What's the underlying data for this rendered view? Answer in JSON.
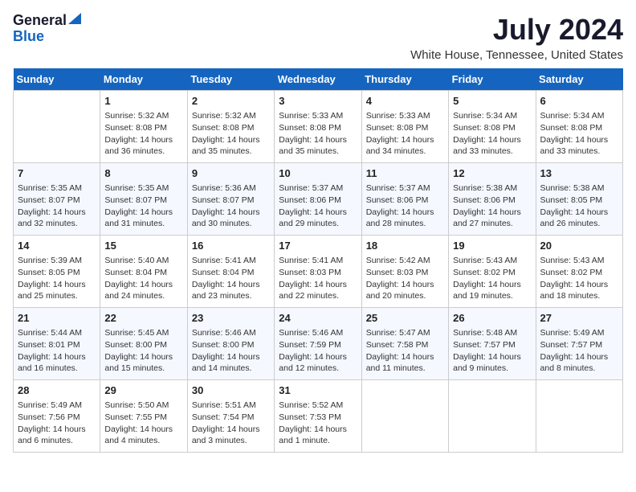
{
  "logo": {
    "general": "General",
    "blue": "Blue"
  },
  "title": "July 2024",
  "location": "White House, Tennessee, United States",
  "days_of_week": [
    "Sunday",
    "Monday",
    "Tuesday",
    "Wednesday",
    "Thursday",
    "Friday",
    "Saturday"
  ],
  "weeks": [
    [
      {
        "day": "",
        "content": ""
      },
      {
        "day": "1",
        "content": "Sunrise: 5:32 AM\nSunset: 8:08 PM\nDaylight: 14 hours\nand 36 minutes."
      },
      {
        "day": "2",
        "content": "Sunrise: 5:32 AM\nSunset: 8:08 PM\nDaylight: 14 hours\nand 35 minutes."
      },
      {
        "day": "3",
        "content": "Sunrise: 5:33 AM\nSunset: 8:08 PM\nDaylight: 14 hours\nand 35 minutes."
      },
      {
        "day": "4",
        "content": "Sunrise: 5:33 AM\nSunset: 8:08 PM\nDaylight: 14 hours\nand 34 minutes."
      },
      {
        "day": "5",
        "content": "Sunrise: 5:34 AM\nSunset: 8:08 PM\nDaylight: 14 hours\nand 33 minutes."
      },
      {
        "day": "6",
        "content": "Sunrise: 5:34 AM\nSunset: 8:08 PM\nDaylight: 14 hours\nand 33 minutes."
      }
    ],
    [
      {
        "day": "7",
        "content": "Sunrise: 5:35 AM\nSunset: 8:07 PM\nDaylight: 14 hours\nand 32 minutes."
      },
      {
        "day": "8",
        "content": "Sunrise: 5:35 AM\nSunset: 8:07 PM\nDaylight: 14 hours\nand 31 minutes."
      },
      {
        "day": "9",
        "content": "Sunrise: 5:36 AM\nSunset: 8:07 PM\nDaylight: 14 hours\nand 30 minutes."
      },
      {
        "day": "10",
        "content": "Sunrise: 5:37 AM\nSunset: 8:06 PM\nDaylight: 14 hours\nand 29 minutes."
      },
      {
        "day": "11",
        "content": "Sunrise: 5:37 AM\nSunset: 8:06 PM\nDaylight: 14 hours\nand 28 minutes."
      },
      {
        "day": "12",
        "content": "Sunrise: 5:38 AM\nSunset: 8:06 PM\nDaylight: 14 hours\nand 27 minutes."
      },
      {
        "day": "13",
        "content": "Sunrise: 5:38 AM\nSunset: 8:05 PM\nDaylight: 14 hours\nand 26 minutes."
      }
    ],
    [
      {
        "day": "14",
        "content": "Sunrise: 5:39 AM\nSunset: 8:05 PM\nDaylight: 14 hours\nand 25 minutes."
      },
      {
        "day": "15",
        "content": "Sunrise: 5:40 AM\nSunset: 8:04 PM\nDaylight: 14 hours\nand 24 minutes."
      },
      {
        "day": "16",
        "content": "Sunrise: 5:41 AM\nSunset: 8:04 PM\nDaylight: 14 hours\nand 23 minutes."
      },
      {
        "day": "17",
        "content": "Sunrise: 5:41 AM\nSunset: 8:03 PM\nDaylight: 14 hours\nand 22 minutes."
      },
      {
        "day": "18",
        "content": "Sunrise: 5:42 AM\nSunset: 8:03 PM\nDaylight: 14 hours\nand 20 minutes."
      },
      {
        "day": "19",
        "content": "Sunrise: 5:43 AM\nSunset: 8:02 PM\nDaylight: 14 hours\nand 19 minutes."
      },
      {
        "day": "20",
        "content": "Sunrise: 5:43 AM\nSunset: 8:02 PM\nDaylight: 14 hours\nand 18 minutes."
      }
    ],
    [
      {
        "day": "21",
        "content": "Sunrise: 5:44 AM\nSunset: 8:01 PM\nDaylight: 14 hours\nand 16 minutes."
      },
      {
        "day": "22",
        "content": "Sunrise: 5:45 AM\nSunset: 8:00 PM\nDaylight: 14 hours\nand 15 minutes."
      },
      {
        "day": "23",
        "content": "Sunrise: 5:46 AM\nSunset: 8:00 PM\nDaylight: 14 hours\nand 14 minutes."
      },
      {
        "day": "24",
        "content": "Sunrise: 5:46 AM\nSunset: 7:59 PM\nDaylight: 14 hours\nand 12 minutes."
      },
      {
        "day": "25",
        "content": "Sunrise: 5:47 AM\nSunset: 7:58 PM\nDaylight: 14 hours\nand 11 minutes."
      },
      {
        "day": "26",
        "content": "Sunrise: 5:48 AM\nSunset: 7:57 PM\nDaylight: 14 hours\nand 9 minutes."
      },
      {
        "day": "27",
        "content": "Sunrise: 5:49 AM\nSunset: 7:57 PM\nDaylight: 14 hours\nand 8 minutes."
      }
    ],
    [
      {
        "day": "28",
        "content": "Sunrise: 5:49 AM\nSunset: 7:56 PM\nDaylight: 14 hours\nand 6 minutes."
      },
      {
        "day": "29",
        "content": "Sunrise: 5:50 AM\nSunset: 7:55 PM\nDaylight: 14 hours\nand 4 minutes."
      },
      {
        "day": "30",
        "content": "Sunrise: 5:51 AM\nSunset: 7:54 PM\nDaylight: 14 hours\nand 3 minutes."
      },
      {
        "day": "31",
        "content": "Sunrise: 5:52 AM\nSunset: 7:53 PM\nDaylight: 14 hours\nand 1 minute."
      },
      {
        "day": "",
        "content": ""
      },
      {
        "day": "",
        "content": ""
      },
      {
        "day": "",
        "content": ""
      }
    ]
  ]
}
